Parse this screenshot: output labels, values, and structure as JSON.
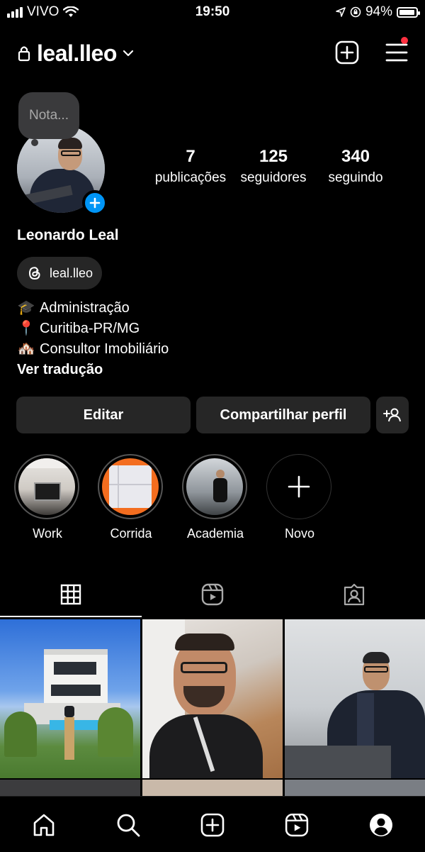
{
  "status_bar": {
    "carrier": "VIVO",
    "time": "19:50",
    "battery": "94%",
    "battery_level": 0.94,
    "icons": [
      "signal-icon",
      "wifi-icon",
      "location-icon",
      "rotation-lock-icon",
      "battery-icon"
    ]
  },
  "header": {
    "username": "leal.lleo",
    "icons": [
      "lock-icon",
      "chevron-down-icon",
      "create-icon",
      "menu-icon"
    ],
    "notification_dot_color": "#ff3040"
  },
  "profile": {
    "note_placeholder": "Nota...",
    "name": "Leonardo Leal",
    "threads_handle": "leal.lleo",
    "stats": [
      {
        "value": "7",
        "label": "publicações"
      },
      {
        "value": "125",
        "label": "seguidores"
      },
      {
        "value": "340",
        "label": "seguindo"
      }
    ],
    "bio": [
      {
        "emoji": "🎓",
        "text": "Administração"
      },
      {
        "emoji": "📍",
        "text": "Curitiba-PR/MG"
      },
      {
        "emoji": "🏘️",
        "text": "Consultor Imobiliário"
      }
    ],
    "translate_link": "Ver tradução"
  },
  "actions": {
    "edit": "Editar",
    "share": "Compartilhar perfil"
  },
  "highlights": [
    {
      "label": "Work"
    },
    {
      "label": "Corrida"
    },
    {
      "label": "Academia"
    },
    {
      "label": "Novo"
    }
  ],
  "tabs": [
    "grid-icon",
    "reels-icon",
    "tagged-icon"
  ],
  "bottom_nav": [
    "home-icon",
    "search-icon",
    "create-icon",
    "reels-icon",
    "profile-icon"
  ],
  "colors": {
    "accent": "#0095f6",
    "surface": "#262626",
    "background": "#000000"
  }
}
